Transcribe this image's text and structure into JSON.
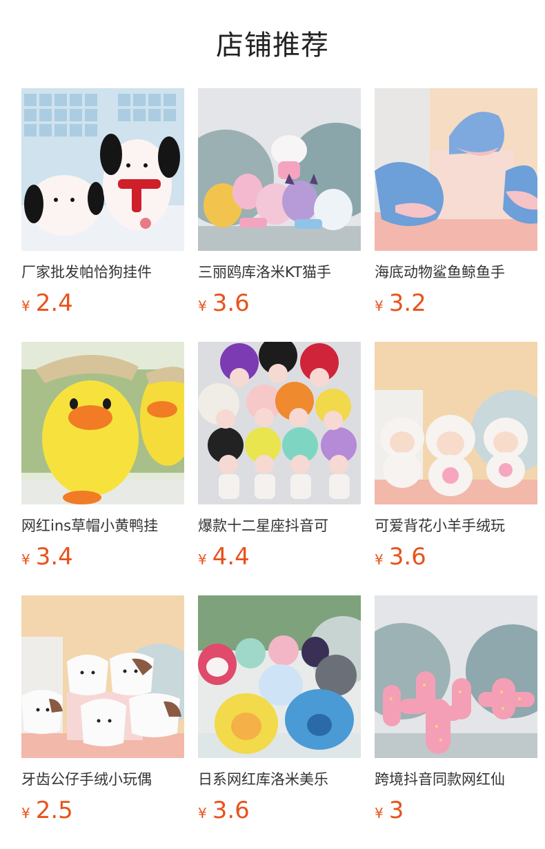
{
  "header": {
    "title": "店铺推荐"
  },
  "products": [
    {
      "title": "厂家批发帕恰狗挂件",
      "currency": "¥",
      "price": "2.4",
      "image": "pochacco-plush-image"
    },
    {
      "title": "三丽鸥库洛米KT猫手",
      "currency": "¥",
      "price": "3.6",
      "image": "sanrio-plush-group-image"
    },
    {
      "title": "海底动物鲨鱼鲸鱼手",
      "currency": "¥",
      "price": "3.2",
      "image": "shark-plush-image"
    },
    {
      "title": "网红ins草帽小黄鸭挂",
      "currency": "¥",
      "price": "3.4",
      "image": "yellow-duck-plush-image"
    },
    {
      "title": "爆款十二星座抖音可",
      "currency": "¥",
      "price": "4.4",
      "image": "troll-doll-plush-image"
    },
    {
      "title": "可爱背花小羊手绒玩",
      "currency": "¥",
      "price": "3.6",
      "image": "lamb-plush-image"
    },
    {
      "title": "牙齿公仔手绒小玩偶",
      "currency": "¥",
      "price": "2.5",
      "image": "tooth-plush-image"
    },
    {
      "title": "日系网红库洛米美乐",
      "currency": "¥",
      "price": "3.6",
      "image": "japanese-plush-group-image"
    },
    {
      "title": "跨境抖音同款网红仙",
      "currency": "¥",
      "price": "3",
      "image": "cactus-plush-image"
    }
  ]
}
